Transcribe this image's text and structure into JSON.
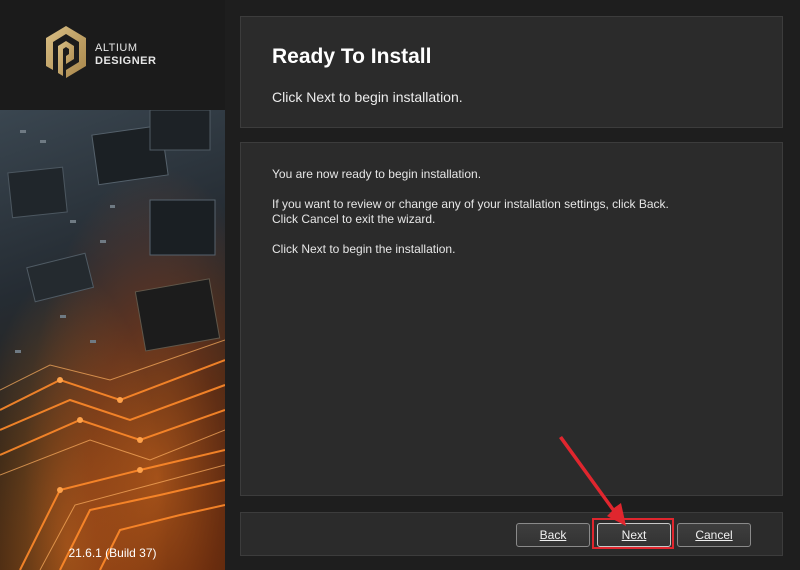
{
  "brand": {
    "line1": "ALTIUM",
    "line2": "DESIGNER",
    "version": "21.6.1 (Build 37)"
  },
  "header": {
    "title": "Ready To Install",
    "subtitle": "Click Next to begin installation."
  },
  "body": {
    "paragraph1": "You are now ready to begin installation.",
    "paragraph2_line1": "If you want to review or change any of your installation settings, click Back.",
    "paragraph2_line2": "Click Cancel to exit the wizard.",
    "paragraph3": "Click Next to begin the installation."
  },
  "buttons": {
    "back": "Back",
    "next": "Next",
    "cancel": "Cancel"
  },
  "colors": {
    "background": "#1e1e1e",
    "panel": "#2b2b2b",
    "highlight": "#e0262e",
    "logo_gold": "#c9a96a"
  }
}
